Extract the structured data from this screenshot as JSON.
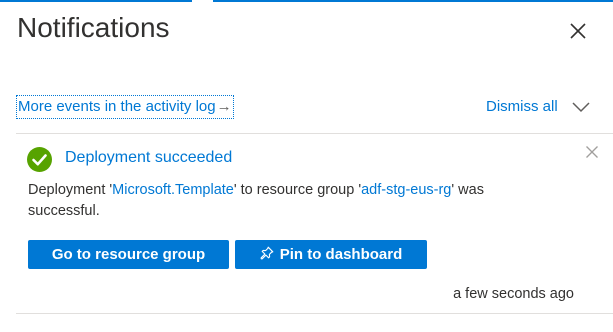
{
  "panel": {
    "title": "Notifications",
    "accent_color": "#0078d4"
  },
  "icons": {
    "close": "close-icon",
    "arrow": "arrow-right-icon",
    "chevron": "chevron-down-icon",
    "success": "checkmark-circle-icon",
    "dismiss": "dismiss-icon",
    "pin": "pin-icon"
  },
  "toolbar": {
    "activity_log_link": "More events in the activity log",
    "arrow_glyph": "→",
    "dismiss_all_label": "Dismiss all"
  },
  "notifications": [
    {
      "status": "success",
      "status_color": "#57a300",
      "title": "Deployment succeeded",
      "body": {
        "prefix": "Deployment '",
        "template_link": "Microsoft.Template",
        "middle": "' to resource group '",
        "rg_link": "adf-stg-eus-rg",
        "suffix": "' was successful."
      },
      "actions": {
        "primary": "Go to resource group",
        "secondary": "Pin to dashboard"
      },
      "timestamp": "a few seconds ago"
    }
  ]
}
